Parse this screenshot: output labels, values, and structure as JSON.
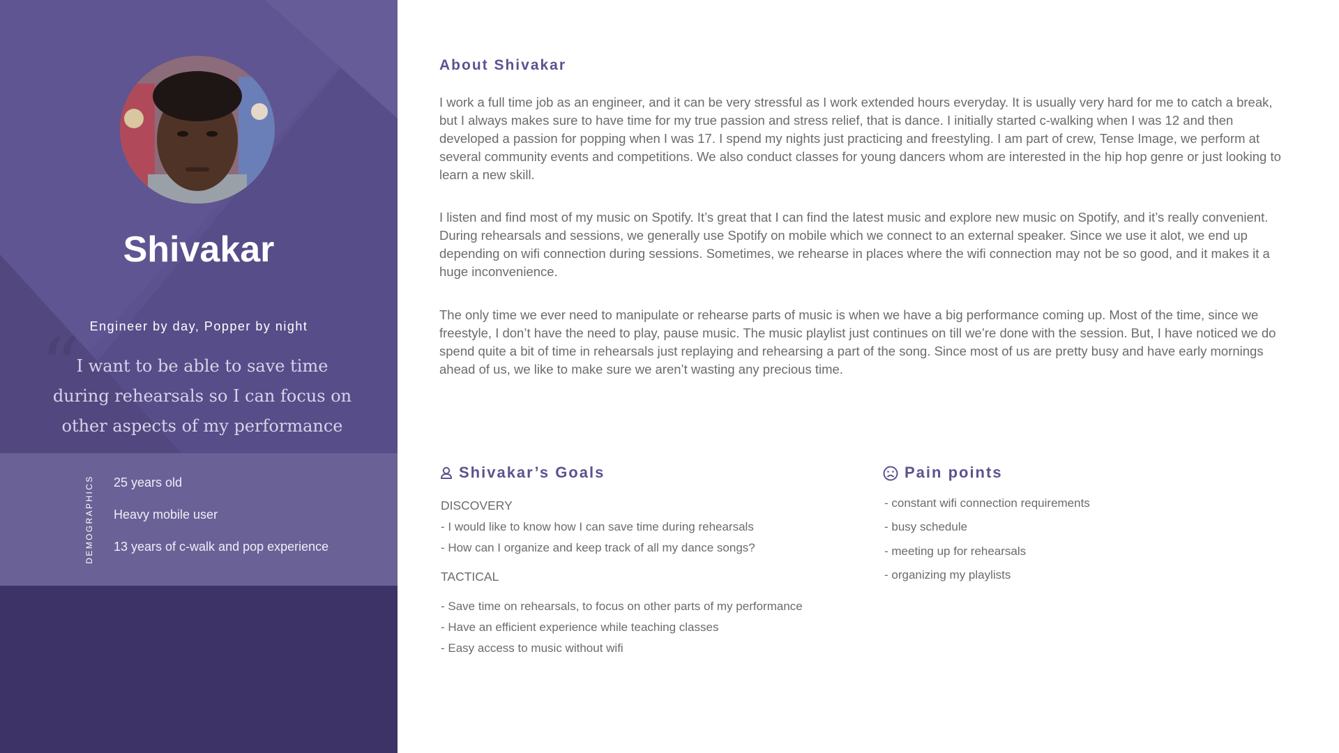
{
  "persona": {
    "name": "Shivakar",
    "tagline": "Engineer by day, Popper by night",
    "quote_mark": "“",
    "quote": "I want to be able to save time during rehearsals so I can focus on other aspects of my performance"
  },
  "demographics": {
    "label": "DEMOGRAPHICS",
    "items": [
      "25 years old",
      "Heavy mobile user",
      "13 years of c-walk and pop experience"
    ]
  },
  "about": {
    "title": "About Shivakar",
    "paragraphs": [
      "I work a full time job as an engineer,  and it can be very stressful as I work extended hours everyday. It is usually very hard for me to catch a break, but I always makes sure to have time for my true passion and stress relief, that is dance. I initially started c-walking when I was 12 and then developed a passion for popping when I was 17. I spend my nights just practicing and freestyling. I am part of crew, Tense Image, we perform at several community events and competitions. We also conduct classes for young dancers whom are interested in the hip hop genre or just looking to learn a new skill.",
      " I listen and find most of my music on Spotify. It’s great that I can find the latest music and explore new music on Spotify, and it’s really convenient. During rehearsals and sessions, we generally use Spotify on mobile which we connect to an external speaker. Since we use it alot, we end up depending on wifi connection during sessions. Sometimes, we rehearse in places where the wifi connection may not be so good, and it makes it a huge inconvenience.",
      "The only time we ever need to manipulate or rehearse parts of music is when we have a big performance coming up. Most of the time, since we freestyle, I don’t have the need to play, pause music. The music playlist just continues on till we’re done with the session. But, I have noticed we do spend quite a bit of time in rehearsals just replaying and rehearsing a part of the song. Since most of us are pretty busy and have early mornings ahead of us, we like to make sure we aren’t wasting any precious time."
    ]
  },
  "goals": {
    "title": "Shivakar’s Goals",
    "icon": "person-icon",
    "discovery_label": "DISCOVERY",
    "discovery": [
      "- I would like to know how I can save time during rehearsals",
      "- How can I organize and keep track of all my dance songs?"
    ],
    "tactical_label": "TACTICAL",
    "tactical": [
      "- Save time on rehearsals, to focus on other parts of my performance",
      "- Have an efficient experience while teaching classes",
      "- Easy access to music without wifi"
    ]
  },
  "pain_points": {
    "title": "Pain points",
    "icon": "sad-face-icon",
    "items": [
      "- constant wifi connection requirements",
      "-  busy schedule",
      "- meeting up for rehearsals",
      "-  organizing my playlists"
    ]
  },
  "colors": {
    "panel_dark": "#3d3366",
    "panel_mid": "#5c528f",
    "panel_demo": "#6a6196",
    "accent": "#5c528f",
    "body_text": "#6b6b6b"
  }
}
